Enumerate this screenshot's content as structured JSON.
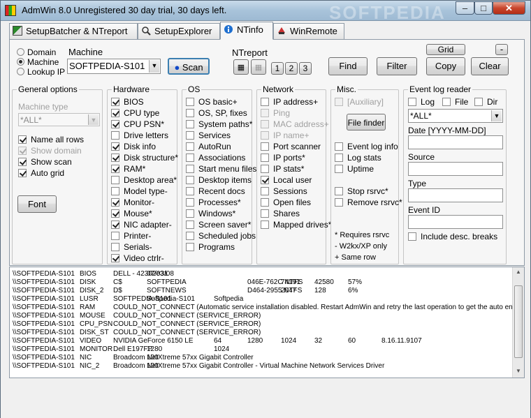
{
  "window": {
    "title": "AdmWin 8.0 Unregistered 30 day trial, 30 days left.",
    "watermark": "SOFTPEDIA",
    "min": "–",
    "max": "□",
    "close": "✕"
  },
  "tabs": [
    {
      "label": "SetupBatcher & NTreport",
      "icon": "setup-icon"
    },
    {
      "label": "SetupExplorer",
      "icon": "search-icon"
    },
    {
      "label": "NTinfo",
      "icon": "info-icon"
    },
    {
      "label": "WinRemote",
      "icon": "remote-icon"
    }
  ],
  "target": {
    "domain": "Domain",
    "machine": "Machine",
    "lookup_ip": "Lookup IP",
    "selected": "Machine",
    "machine_label": "Machine",
    "machine_value": "SOFTPEDIA-S101",
    "scan": "Scan"
  },
  "ntreport": {
    "label": "NTreport",
    "b1": "1",
    "b2": "2",
    "b3": "3"
  },
  "buttons": {
    "find": "Find",
    "filter": "Filter",
    "grid": "Grid",
    "copy": "Copy",
    "clear": "Clear",
    "minus": "-",
    "font": "Font",
    "file_finder": "File finder"
  },
  "general": {
    "title": "General options",
    "machine_type_label": "Machine type",
    "machine_type_value": "*ALL*",
    "name_all_rows": "Name all rows",
    "show_domain": "Show domain",
    "show_scan": "Show scan",
    "auto_grid": "Auto grid"
  },
  "hardware": {
    "title": "Hardware",
    "items": [
      {
        "label": "BIOS",
        "on": true
      },
      {
        "label": "CPU type",
        "on": true
      },
      {
        "label": "CPU PSN*",
        "on": true
      },
      {
        "label": "Drive letters",
        "on": false
      },
      {
        "label": "Disk info",
        "on": true
      },
      {
        "label": "Disk structure*",
        "on": true
      },
      {
        "label": "RAM*",
        "on": true
      },
      {
        "label": "Desktop area*",
        "on": false
      },
      {
        "label": "Model type-",
        "on": false
      },
      {
        "label": "Monitor-",
        "on": true
      },
      {
        "label": "Mouse*",
        "on": true
      },
      {
        "label": "NIC adapter-",
        "on": true
      },
      {
        "label": "Printer-",
        "on": false
      },
      {
        "label": "Serials-",
        "on": false
      },
      {
        "label": "Video ctrlr-",
        "on": true
      }
    ]
  },
  "os": {
    "title": "OS",
    "items": [
      "OS basic+",
      "OS, SP, fixes",
      "System paths*",
      "Services",
      "AutoRun",
      "Associations",
      "Start menu files",
      "Desktop items",
      "Recent docs",
      "Processes*",
      "Windows*",
      "Screen saver*",
      "Scheduled jobs",
      "Programs"
    ]
  },
  "network": {
    "title": "Network",
    "items": [
      {
        "label": "IP address+",
        "on": false,
        "dis": false
      },
      {
        "label": "Ping",
        "on": false,
        "dis": true
      },
      {
        "label": "MAC address+",
        "on": false,
        "dis": true
      },
      {
        "label": "IP name+",
        "on": false,
        "dis": true
      },
      {
        "label": "Port scanner",
        "on": false,
        "dis": false
      },
      {
        "label": "IP ports*",
        "on": false,
        "dis": false
      },
      {
        "label": "IP stats*",
        "on": false,
        "dis": false
      },
      {
        "label": "Local user",
        "on": true,
        "dis": false
      },
      {
        "label": "Sessions",
        "on": false,
        "dis": false
      },
      {
        "label": "Open files",
        "on": false,
        "dis": false
      },
      {
        "label": "Shares",
        "on": false,
        "dis": false
      },
      {
        "label": "Mapped drives*",
        "on": false,
        "dis": false
      }
    ]
  },
  "misc": {
    "title": "Misc.",
    "auxiliary": "[Auxiliary]",
    "event_log_info": "Event log info",
    "log_stats": "Log stats",
    "uptime": "Uptime",
    "stop_rsrvc": "Stop rsrvc*",
    "remove_rsrvc": "Remove rsrvc*",
    "note1": "* Requires rsrvc",
    "note2": "- W2kx/XP only",
    "note3": "+ Same row"
  },
  "eventlog": {
    "title": "Event log reader",
    "log": "Log",
    "file": "File",
    "dir": "Dir",
    "filter_value": "*ALL*",
    "date_label": "Date  [YYYY-MM-DD]",
    "source_label": "Source",
    "type_label": "Type",
    "event_id_label": "Event ID",
    "include_desc": "Include desc. breaks"
  },
  "output": [
    [
      "\\\\SOFTPEDIA-S101",
      "BIOS",
      "DELL   - 42302e31",
      "07/03/08",
      "",
      "",
      "",
      "",
      "",
      ""
    ],
    [
      "\\\\SOFTPEDIA-S101",
      "DISK",
      "C$",
      "SOFTPEDIA",
      "",
      "046E-762C NTFS",
      "74191",
      "42580",
      "57%",
      ""
    ],
    [
      "\\\\SOFTPEDIA-S101",
      "DISK_2",
      "D$",
      "SOFTNEWS",
      "",
      "D464-2955 NTFS",
      "2047",
      "128",
      "6%",
      ""
    ],
    [
      "\\\\SOFTPEDIA-S101",
      "LUSR",
      "SOFTPEDIA-S101",
      "Softpedia-S101",
      "Softpedia",
      "",
      "",
      "",
      "",
      ""
    ],
    [
      "\\\\SOFTPEDIA-S101",
      "RAM",
      "COULD_NOT_CONNECT (Automatic service installation disabled. Restart AdmWin and retry the last operation to get the auto enable d",
      "",
      "",
      "",
      "",
      "",
      "",
      ""
    ],
    [
      "\\\\SOFTPEDIA-S101",
      "MOUSE",
      "COULD_NOT_CONNECT (SERVICE_ERROR)",
      "",
      "",
      "",
      "",
      "",
      "",
      ""
    ],
    [
      "\\\\SOFTPEDIA-S101",
      "CPU_PSN",
      "COULD_NOT_CONNECT (SERVICE_ERROR)",
      "",
      "",
      "",
      "",
      "",
      "",
      ""
    ],
    [
      "\\\\SOFTPEDIA-S101",
      "DISK_ST",
      "COULD_NOT_CONNECT (SERVICE_ERROR)",
      "",
      "",
      "",
      "",
      "",
      "",
      ""
    ],
    [
      "\\\\SOFTPEDIA-S101",
      "VIDEO",
      "NVIDIA GeForce 6150 LE",
      "",
      "64",
      "1280",
      "1024",
      "32",
      "60",
      "8.16.11.9107"
    ],
    [
      "\\\\SOFTPEDIA-S101",
      "MONITOR",
      "Dell E197FP",
      "1280",
      "1024",
      "",
      "",
      "",
      "",
      ""
    ],
    [
      "\\\\SOFTPEDIA-S101",
      "NIC",
      "Broadcom NetXtreme 57xx Gigabit Controller",
      "100",
      "",
      "",
      "",
      "",
      "",
      ""
    ],
    [
      "\\\\SOFTPEDIA-S101",
      "NIC_2",
      "Broadcom NetXtreme 57xx Gigabit Controller - Virtual Machine Network Services Driver",
      "100",
      "",
      "",
      "",
      "",
      "",
      ""
    ]
  ]
}
